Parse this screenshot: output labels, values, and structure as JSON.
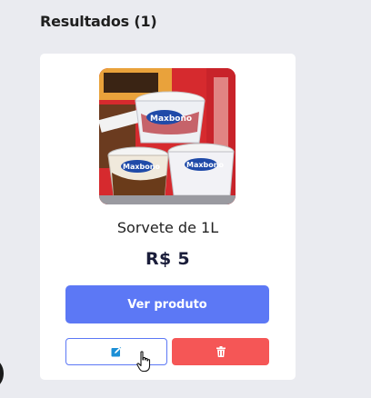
{
  "results": {
    "title": "Resultados (1)"
  },
  "product": {
    "image_alt": "Sorvete Maxbonn",
    "image_brand_text": "Maxbono",
    "name": "Sorvete de 1L",
    "price": "R$ 5",
    "view_button_label": "Ver produto",
    "edit_icon": "edit-square-icon",
    "delete_icon": "trash-icon"
  },
  "colors": {
    "page_background": "#eaebf0",
    "card_background": "#ffffff",
    "primary": "#5c78f5",
    "danger": "#f55656",
    "price_text": "#1a1d3a"
  }
}
